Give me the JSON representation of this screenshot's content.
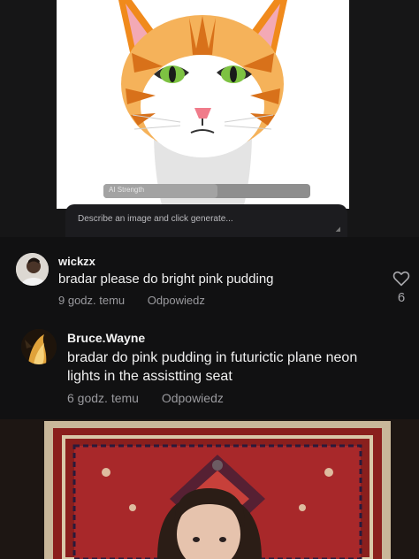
{
  "ai_app": {
    "strength_label": "AI Strength",
    "strength_level": 0.55,
    "prompt_placeholder": "Describe an image and click generate..."
  },
  "comments": [
    {
      "username": "wickzx",
      "text": "bradar please do bright pink pudding",
      "time": "9 godz. temu",
      "reply_label": "Odpowiedz",
      "likes": "6"
    },
    {
      "username": "Bruce.Wayne",
      "text": "bradar do pink pudding in futurictic plane neon lights in the assistting seat",
      "time": "6 godz. temu",
      "reply_label": "Odpowiedz"
    }
  ],
  "colors": {
    "background": "#111112",
    "cat_orange": "#f08a1c",
    "cat_eye": "#7dc242",
    "rug_red": "#a8282a"
  },
  "icons": [
    "heart-icon",
    "resize-handle-icon"
  ]
}
